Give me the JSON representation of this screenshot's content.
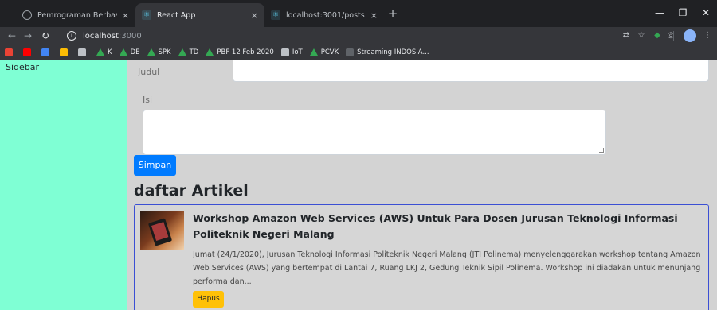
{
  "browser": {
    "tabs": [
      {
        "title": "Pemrograman Berbasis Framewo",
        "icon": "globe-icon",
        "active": false
      },
      {
        "title": "React App",
        "icon": "react-icon",
        "active": true
      },
      {
        "title": "localhost:3001/posts",
        "icon": "react-icon",
        "active": false
      }
    ],
    "close_glyph": "×",
    "new_tab_glyph": "+",
    "address": {
      "host": "localhost",
      "port": ":3000"
    },
    "bookmarks": [
      {
        "label": "",
        "icon": "gmail-icon",
        "color": "#ea4335"
      },
      {
        "label": "",
        "icon": "youtube-icon",
        "color": "#ff0000"
      },
      {
        "label": "",
        "icon": "translate-icon",
        "color": "#4285f4"
      },
      {
        "label": "",
        "icon": "infinity-icon",
        "color": "#fbbc04"
      },
      {
        "label": "",
        "icon": "apps-icon",
        "color": "#bdc1c6"
      },
      {
        "label": "K",
        "icon": "drive-icon"
      },
      {
        "label": "DE",
        "icon": "drive-icon"
      },
      {
        "label": "SPK",
        "icon": "drive-icon"
      },
      {
        "label": "TD",
        "icon": "drive-icon"
      },
      {
        "label": "PBF 12 Feb 2020",
        "icon": "drive-icon"
      },
      {
        "label": "IoT",
        "icon": "apps-icon",
        "color": "#bdc1c6"
      },
      {
        "label": "PCVK",
        "icon": "drive-icon"
      },
      {
        "label": "Streaming INDOSIA...",
        "icon": "film-icon",
        "color": "#5f6368"
      }
    ]
  },
  "sidebar": {
    "label": "Sidebar"
  },
  "form": {
    "judul_label": "Judul",
    "isi_label": "Isi",
    "judul_value": "",
    "isi_value": "",
    "submit_label": "Simpan"
  },
  "articles": {
    "heading": "daftar Artikel",
    "items": [
      {
        "title": "Workshop Amazon Web Services (AWS) Untuk Para Dosen Jurusan Teknologi Informasi Politeknik Negeri Malang",
        "body": "Jumat (24/1/2020), Jurusan Teknologi Informasi Politeknik Negeri Malang (JTI Polinema) menyelenggarakan workshop tentang Amazon Web Services (AWS) yang bertempat di Lantai 7, Ruang LKJ 2, Gedung Teknik Sipil Polinema. Workshop ini diadakan untuk menunjang performa dan...",
        "delete_label": "Hapus"
      }
    ]
  },
  "colors": {
    "sidebar_bg": "#7fffd4",
    "page_bg": "#d3d3d3",
    "primary": "#007bff",
    "warning": "#ffc107",
    "card_border": "#3b4fd4"
  }
}
